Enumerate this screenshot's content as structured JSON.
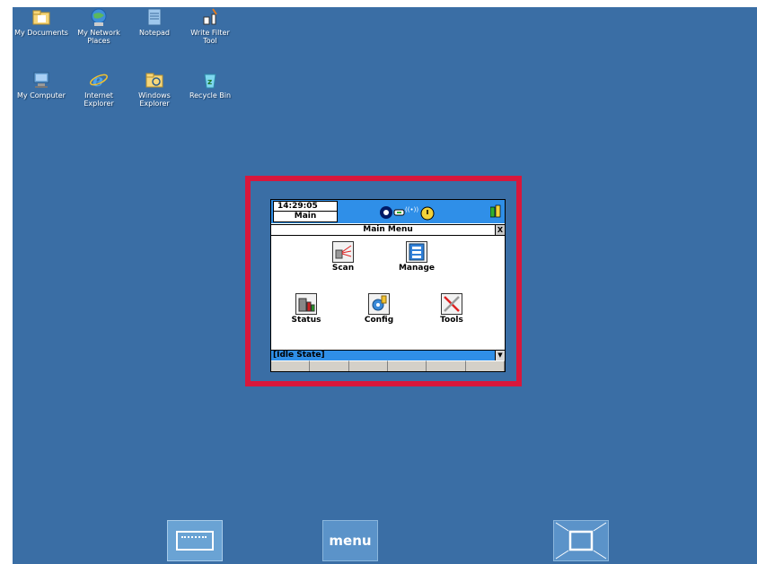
{
  "desktop": {
    "icons": [
      {
        "label": "My Documents"
      },
      {
        "label": "My Network Places"
      },
      {
        "label": "Notepad"
      },
      {
        "label": "Write Filter Tool"
      },
      {
        "label": "My Computer"
      },
      {
        "label": "Internet Explorer"
      },
      {
        "label": "Windows Explorer"
      },
      {
        "label": "Recycle Bin"
      }
    ]
  },
  "device": {
    "time": "14:29:05",
    "mode": "Main",
    "title": "Main Menu",
    "close_label": "X",
    "apps": [
      {
        "label": "Scan"
      },
      {
        "label": "Manage"
      },
      {
        "label": "Status"
      },
      {
        "label": "Config"
      },
      {
        "label": "Tools"
      }
    ],
    "status_text": "[Idle State]",
    "dropdown_label": "▼"
  },
  "bottom_bar": {
    "menu_label": "menu"
  },
  "colors": {
    "desktop_bg": "#3a6ea5",
    "highlight_frame": "#d8173c",
    "device_bar": "#2f8fe8"
  }
}
